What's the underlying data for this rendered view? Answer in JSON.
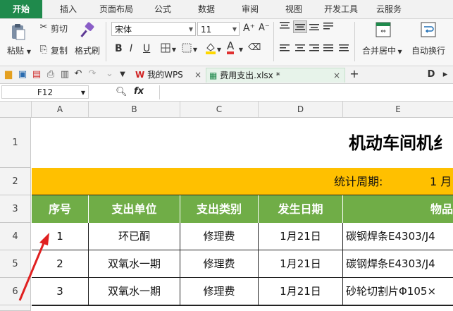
{
  "menu_tabs": [
    "开始",
    "插入",
    "页面布局",
    "公式",
    "数据",
    "审阅",
    "视图",
    "开发工具",
    "云服务"
  ],
  "ribbon": {
    "paste": "粘贴",
    "cut": "剪切",
    "copy": "复制",
    "format_painter": "格式刷",
    "font_name": "宋体",
    "font_size": "11",
    "grow_font": "A⁺",
    "shrink_font": "A⁻",
    "bold": "B",
    "italic": "I",
    "underline": "U",
    "font_color_letter": "A",
    "merge_center": "合并居中",
    "wrap_text": "自动换行"
  },
  "doc_tabs": [
    {
      "label": "我的WPS",
      "icon": "wps-icon"
    },
    {
      "label": "费用支出.xlsx *",
      "icon": "spreadsheet-icon"
    }
  ],
  "formula_bar": {
    "cell_ref": "F12",
    "fx": "fx",
    "content": ""
  },
  "columns": [
    "A",
    "B",
    "C",
    "D",
    "E"
  ],
  "rows": [
    "1",
    "2",
    "3",
    "4",
    "5",
    "6"
  ],
  "sheet": {
    "title": "机动车间机纟",
    "period_label": "统计周期:",
    "period_value": "1  月",
    "headers": [
      "序号",
      "支出单位",
      "支出类别",
      "发生日期",
      "物品"
    ],
    "data": [
      [
        "1",
        "环已酮",
        "修理费",
        "1月21日",
        "碳钢焊条E4303/J4"
      ],
      [
        "2",
        "双氧水一期",
        "修理费",
        "1月21日",
        "碳钢焊条E4303/J4"
      ],
      [
        "3",
        "双氧水一期",
        "修理费",
        "1月21日",
        "砂轮切割片Φ105×"
      ]
    ]
  },
  "colors": {
    "accent_green": "#1f8a4c",
    "header_green": "#70ad47",
    "period_row": "#ffc000",
    "annotation_arrow": "#e02020",
    "font_color_bar": "#e03030",
    "fill_color_bar": "#ffd800"
  }
}
